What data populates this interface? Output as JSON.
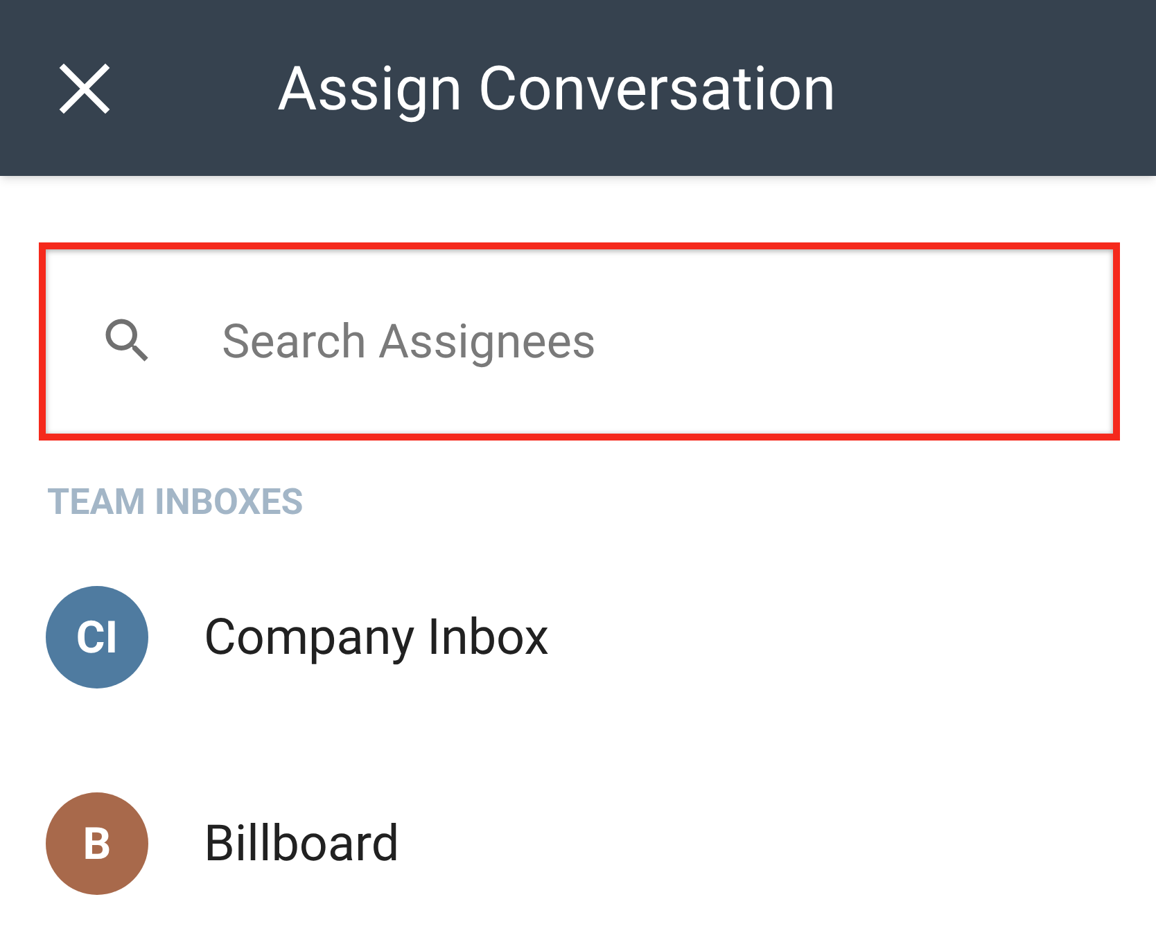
{
  "header": {
    "title": "Assign Conversation"
  },
  "search": {
    "placeholder": "Search Assignees",
    "highlighted": true
  },
  "section": {
    "heading": "TEAM INBOXES"
  },
  "assignees": [
    {
      "initials": "CI",
      "name": "Company Inbox",
      "color": "#4f7ba0"
    },
    {
      "initials": "B",
      "name": "Billboard",
      "color": "#a8694b"
    }
  ]
}
